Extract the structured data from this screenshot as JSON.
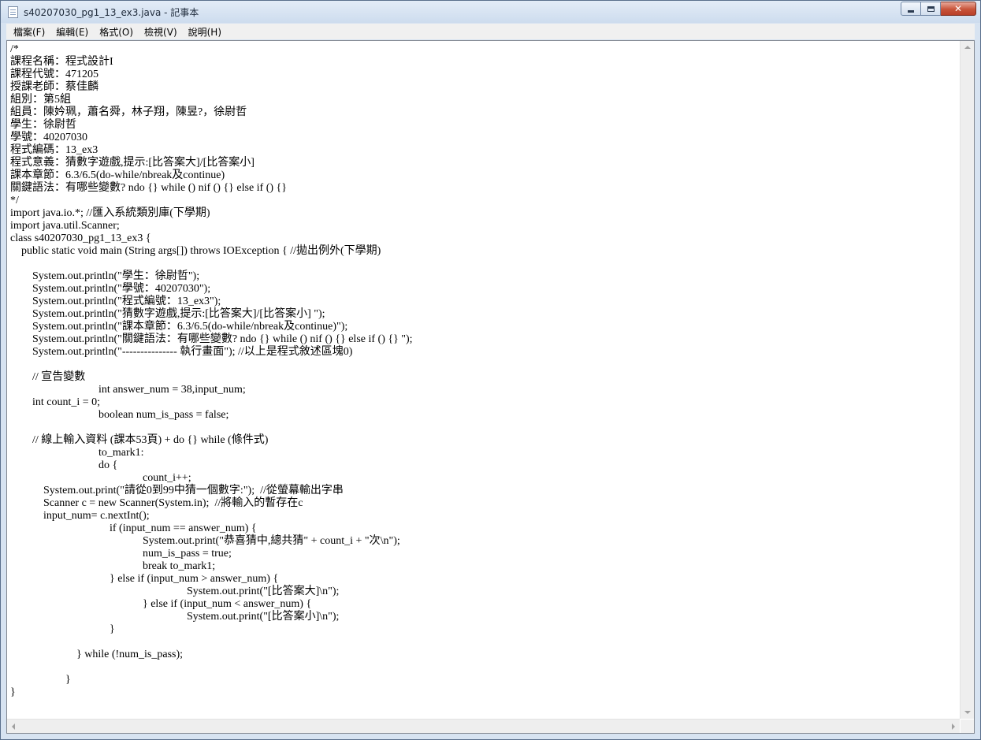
{
  "window": {
    "title": "s40207030_pg1_13_ex3.java - 記事本",
    "buttons": {
      "close": "✕"
    }
  },
  "menu": {
    "items": [
      "檔案(F)",
      "編輯(E)",
      "格式(O)",
      "檢視(V)",
      "說明(H)"
    ]
  },
  "editor": {
    "text": "/*\n課程名稱：程式設計I\n課程代號：471205\n授課老師：蔡佳麟\n組別：第5組\n組員：陳妗珮，蕭名舜，林子翔，陳昱?，徐尉哲\n學生：徐尉哲\n學號：40207030\n程式編碼：13_ex3\n程式意義：猜數字遊戲,提示:[比答案大]/[比答案小]\n課本章節：6.3/6.5(do-while/nbreak及continue)\n關鍵語法：有哪些變數? ndo {} while () nif () {} else if () {}\n*/\nimport java.io.*; //匯入系統類別庫(下學期)\nimport java.util.Scanner;\nclass s40207030_pg1_13_ex3 {\n    public static void main (String args[]) throws IOException { //拋出例外(下學期)\n\n        System.out.println(\"學生：徐尉哲\");\n        System.out.println(\"學號：40207030\");\n        System.out.println(\"程式編號：13_ex3\");\n        System.out.println(\"猜數字遊戲,提示:[比答案大]/[比答案小] \");\n        System.out.println(\"課本章節：6.3/6.5(do-while/nbreak及continue)\");\n        System.out.println(\"關鍵語法：有哪些變數? ndo {} while () nif () {} else if () {} \");\n        System.out.println(\"--------------- 執行畫面\"); //以上是程式敘述區塊0)\n\n        // 宣告變數\n                                int answer_num = 38,input_num;\n        int count_i = 0;\n                                boolean num_is_pass = false;\n\n        // 線上輸入資料 (課本53頁) + do {} while (條件式)\n                                to_mark1:\n                                do {\n                                                count_i++;\n            System.out.print(\"請從0到99中猜一個數字:\");  //從螢幕輸出字串\n            Scanner c = new Scanner(System.in);  //將輸入的暫存在c\n            input_num= c.nextInt();\n                                    if (input_num == answer_num) {\n                                                System.out.print(\"恭喜猜中,總共猜\" + count_i + \"次\\n\");\n                                                num_is_pass = true;\n                                                break to_mark1;\n                                    } else if (input_num > answer_num) {\n                                                                System.out.print(\"[比答案大]\\n\");\n                                                } else if (input_num < answer_num) {\n                                                                System.out.print(\"[比答案小]\\n\");\n                                    }\n\n                        } while (!num_is_pass);\n\n                    }\n}"
  }
}
